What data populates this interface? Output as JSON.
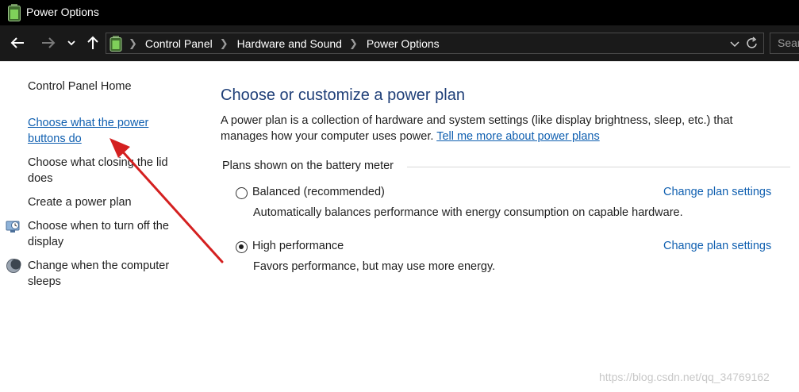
{
  "window": {
    "title": "Power Options",
    "icon": "battery-icon"
  },
  "nav": {
    "back_icon": "back-arrow-icon",
    "forward_icon": "forward-arrow-icon",
    "recent_icon": "chevron-down-icon",
    "up_icon": "up-arrow-icon",
    "breadcrumbs": [
      "Control Panel",
      "Hardware and Sound",
      "Power Options"
    ],
    "search_placeholder": "Sear"
  },
  "sidebar": {
    "home": "Control Panel Home",
    "items": [
      {
        "label": "Choose what the power buttons do",
        "style": "link"
      },
      {
        "label": "Choose what closing the lid does",
        "style": "plain"
      },
      {
        "label": "Create a power plan",
        "style": "plain"
      },
      {
        "label": "Choose when to turn off the display",
        "style": "plain",
        "icon": "display-icon"
      },
      {
        "label": "Change when the computer sleeps",
        "style": "plain",
        "icon": "moon-icon"
      }
    ]
  },
  "main": {
    "heading": "Choose or customize a power plan",
    "description": "A power plan is a collection of hardware and system settings (like display brightness, sleep, etc.) that manages how your computer uses power.",
    "learn_more": "Tell me more about power plans",
    "group_label": "Plans shown on the battery meter",
    "plans": [
      {
        "name": "Balanced (recommended)",
        "description": "Automatically balances performance with energy consumption on capable hardware.",
        "selected": false,
        "action": "Change plan settings"
      },
      {
        "name": "High performance",
        "description": "Favors performance, but may use more energy.",
        "selected": true,
        "action": "Change plan settings"
      }
    ]
  },
  "watermark": "https://blog.csdn.net/qq_34769162",
  "colors": {
    "link": "#0f5fb0",
    "heading": "#1f3f78",
    "annotation_arrow": "#d42020",
    "titlebar": "#000000",
    "navbar": "#191919"
  }
}
